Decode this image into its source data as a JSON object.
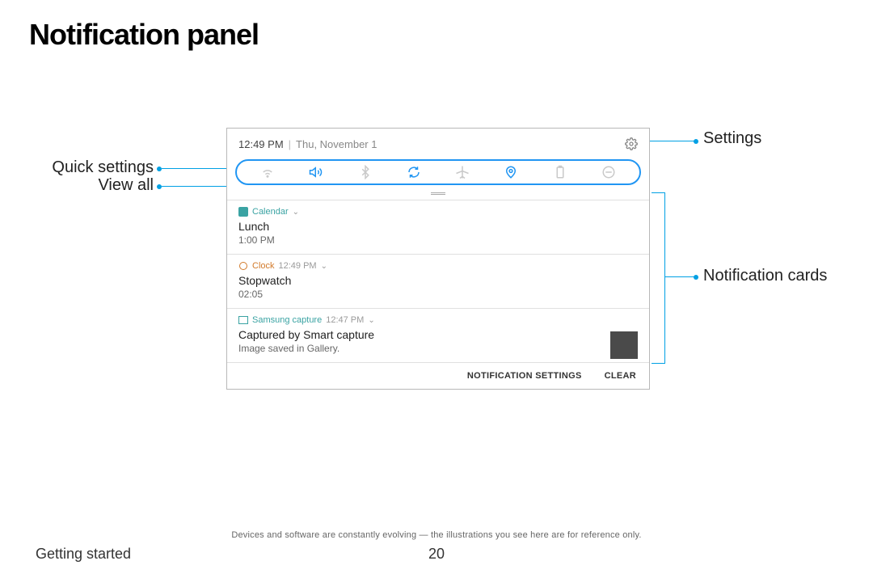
{
  "page": {
    "title": "Notification panel",
    "section": "Getting started",
    "page_number": "20",
    "disclaimer": "Devices and software are constantly evolving — the illustrations you see here are for reference only."
  },
  "callouts": {
    "settings": "Settings",
    "quick_settings": "Quick settings",
    "view_all": "View all",
    "notification_cards": "Notification cards"
  },
  "panel": {
    "time": "12:49 PM",
    "date": "Thu, November 1",
    "footer": {
      "notification_settings": "NOTIFICATION SETTINGS",
      "clear": "CLEAR"
    }
  },
  "cards": [
    {
      "app": "Calendar",
      "app_time": "",
      "title": "Lunch",
      "sub": "1:00 PM",
      "color": "teal"
    },
    {
      "app": "Clock",
      "app_time": "12:49 PM",
      "title": "Stopwatch",
      "sub": "02:05",
      "color": "orange"
    },
    {
      "app": "Samsung capture",
      "app_time": "12:47 PM",
      "title": "Captured by Smart capture",
      "sub": "Image saved in Gallery.",
      "color": "teal"
    }
  ]
}
